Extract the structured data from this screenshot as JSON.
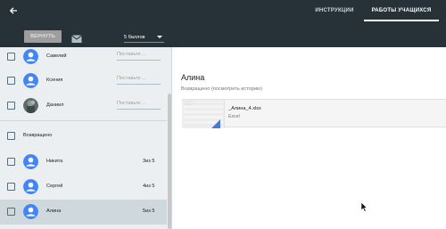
{
  "header": {
    "tabs": [
      {
        "label": "ИНСТРУКЦИИ",
        "active": false
      },
      {
        "label": "РАБОТЫ УЧАЩИХСЯ",
        "active": true
      }
    ],
    "back_icon": "arrow-left-icon"
  },
  "toolbar": {
    "return_label": "ВЕРНУТЬ",
    "mail_icon": "mail-icon",
    "points_value": "5 баллов"
  },
  "students": [
    {
      "name": "Савелий",
      "grade_placeholder": "Поставьте ...",
      "avatar": "default-avatar"
    },
    {
      "name": "Ксения",
      "grade_placeholder": "Поставьте ...",
      "avatar": "default-avatar"
    },
    {
      "name": "Даниил",
      "grade_placeholder": "Поставьте ...",
      "avatar": "photo-avatar"
    }
  ],
  "returned": {
    "label": "Возвращено",
    "students": [
      {
        "name": "Никита",
        "grade": "3из 5"
      },
      {
        "name": "Сергей",
        "grade": "4из 5"
      },
      {
        "name": "Алина",
        "grade": "5из 5",
        "selected": true
      }
    ]
  },
  "detail": {
    "student_name": "Алина",
    "status": "Возвращено (посмотреть историю)",
    "file": {
      "name": "_Алина_4.xlsx",
      "type": "Excel"
    }
  },
  "colors": {
    "header_bg": "#263238",
    "sidebar_bg": "#eceff1",
    "selected_row": "#cfd8dc",
    "avatar_blue": "#4285f4",
    "excel_corner": "#4a78d4"
  }
}
